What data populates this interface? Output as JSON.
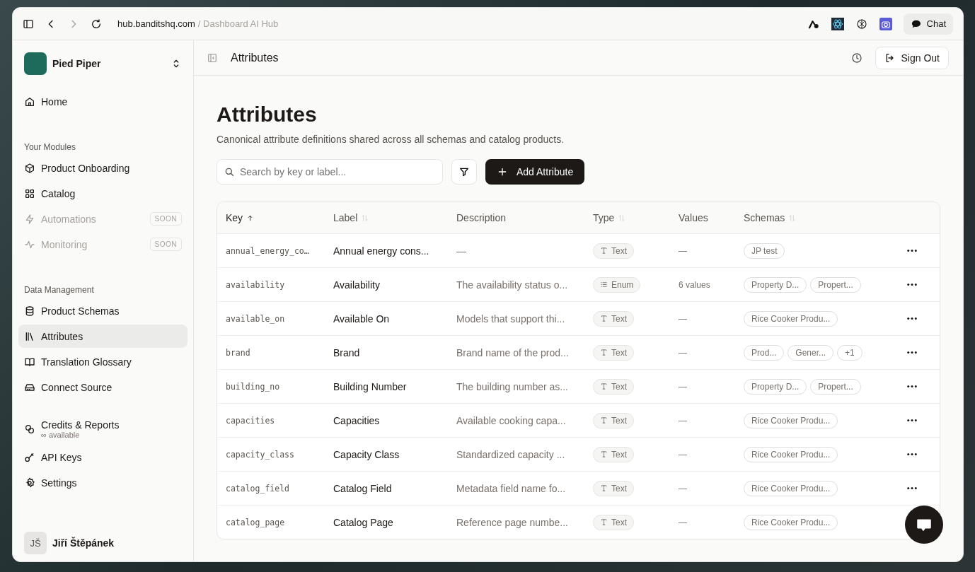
{
  "browser": {
    "host": "hub.banditshq.com",
    "path": "/ Dashboard AI Hub",
    "chat_button": "Chat"
  },
  "sidebar": {
    "workspace": "Pied Piper",
    "groups": [
      {
        "items": [
          {
            "label": "Home",
            "selected": false,
            "disabled": false
          }
        ]
      },
      {
        "title": "Your Modules",
        "items": [
          {
            "label": "Product Onboarding",
            "selected": false,
            "disabled": false
          },
          {
            "label": "Catalog",
            "selected": false,
            "disabled": false
          },
          {
            "label": "Automations",
            "selected": false,
            "disabled": true,
            "badge": "SOON"
          },
          {
            "label": "Monitoring",
            "selected": false,
            "disabled": true,
            "badge": "SOON"
          }
        ]
      },
      {
        "title": "Data Management",
        "items": [
          {
            "label": "Product Schemas",
            "selected": false,
            "disabled": false
          },
          {
            "label": "Attributes",
            "selected": true,
            "disabled": false
          },
          {
            "label": "Translation Glossary",
            "selected": false,
            "disabled": false
          },
          {
            "label": "Connect Source",
            "selected": false,
            "disabled": false
          }
        ]
      },
      {
        "items": [
          {
            "label": "Credits & Reports",
            "sub": "∞ available",
            "selected": false,
            "disabled": false
          },
          {
            "label": "API Keys",
            "selected": false,
            "disabled": false
          },
          {
            "label": "Settings",
            "selected": false,
            "disabled": false
          }
        ]
      }
    ],
    "user": {
      "initials": "JŠ",
      "name": "Jiří Štěpánek"
    }
  },
  "header": {
    "title": "Attributes",
    "sign_out": "Sign Out"
  },
  "page": {
    "title": "Attributes",
    "subtitle": "Canonical attribute definitions shared across all schemas and catalog products.",
    "search": {
      "placeholder": "Search by key or label..."
    },
    "add_button": "Add Attribute"
  },
  "table": {
    "columns": [
      {
        "label": "Key",
        "sortable": true,
        "sorted": true
      },
      {
        "label": "Label",
        "sortable": true,
        "sorted": false
      },
      {
        "label": "Description",
        "sortable": false,
        "sorted": false
      },
      {
        "label": "Type",
        "sortable": true,
        "sorted": false
      },
      {
        "label": "Values",
        "sortable": false,
        "sorted": false
      },
      {
        "label": "Schemas",
        "sortable": true,
        "sorted": false
      }
    ],
    "rows": [
      {
        "key": "annual_energy_co…",
        "label": "Annual energy cons...",
        "description": "—",
        "type": {
          "kind": "text",
          "label": "Text"
        },
        "values": "—",
        "schemas": [
          "JP test"
        ]
      },
      {
        "key": "availability",
        "label": "Availability",
        "description": "The availability status o...",
        "type": {
          "kind": "enum",
          "label": "Enum"
        },
        "values": "6 values",
        "schemas": [
          "Property D...",
          "Propert..."
        ]
      },
      {
        "key": "available_on",
        "label": "Available On",
        "description": "Models that support thi...",
        "type": {
          "kind": "text",
          "label": "Text"
        },
        "values": "—",
        "schemas": [
          "Rice Cooker Produ..."
        ]
      },
      {
        "key": "brand",
        "label": "Brand",
        "description": "Brand name of the prod...",
        "type": {
          "kind": "text",
          "label": "Text"
        },
        "values": "—",
        "schemas": [
          "Prod...",
          "Gener...",
          "+1"
        ]
      },
      {
        "key": "building_no",
        "label": "Building Number",
        "description": "The building number as...",
        "type": {
          "kind": "text",
          "label": "Text"
        },
        "values": "—",
        "schemas": [
          "Property D...",
          "Propert..."
        ]
      },
      {
        "key": "capacities",
        "label": "Capacities",
        "description": "Available cooking capa...",
        "type": {
          "kind": "text",
          "label": "Text"
        },
        "values": "—",
        "schemas": [
          "Rice Cooker Produ..."
        ]
      },
      {
        "key": "capacity_class",
        "label": "Capacity Class",
        "description": "Standardized capacity ...",
        "type": {
          "kind": "text",
          "label": "Text"
        },
        "values": "—",
        "schemas": [
          "Rice Cooker Produ..."
        ]
      },
      {
        "key": "catalog_field",
        "label": "Catalog Field",
        "description": "Metadata field name fo...",
        "type": {
          "kind": "text",
          "label": "Text"
        },
        "values": "—",
        "schemas": [
          "Rice Cooker Produ..."
        ]
      },
      {
        "key": "catalog_page",
        "label": "Catalog Page",
        "description": "Reference page numbe...",
        "type": {
          "kind": "text",
          "label": "Text"
        },
        "values": "—",
        "schemas": [
          "Rice Cooker Produ..."
        ]
      }
    ]
  }
}
